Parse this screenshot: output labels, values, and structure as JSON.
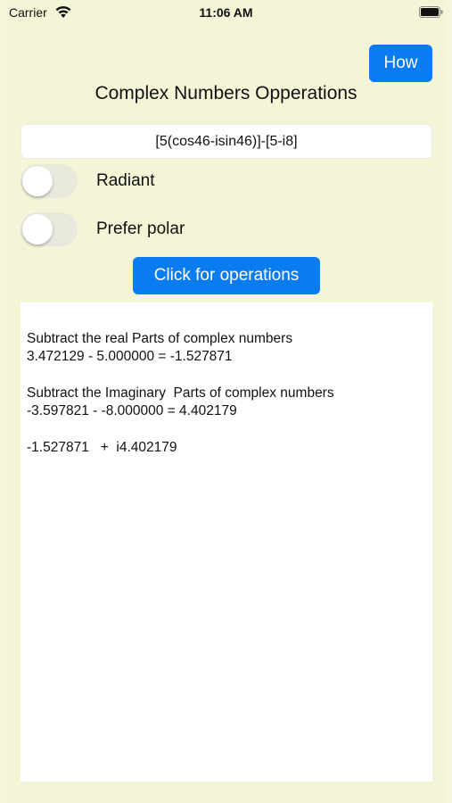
{
  "status_bar": {
    "carrier": "Carrier",
    "time": "11:06 AM"
  },
  "header": {
    "how_label": "How",
    "title": "Complex Numbers Opperations"
  },
  "input": {
    "expression": "[5(cos46-isin46)]-[5-i8]"
  },
  "toggles": [
    {
      "label": "Radiant",
      "on": false
    },
    {
      "label": "Prefer polar",
      "on": false
    }
  ],
  "ops_button_label": "Click for operations",
  "result": {
    "real_heading": "Subtract the real Parts of complex numbers",
    "real_calc": "3.472129 - 5.000000 = -1.527871",
    "imag_heading": "Subtract the Imaginary  Parts of complex numbers",
    "imag_calc": "-3.597821 - -8.000000 = 4.402179",
    "final": "-1.527871   +  i4.402179"
  },
  "colors": {
    "accent": "#0a7cf2",
    "background": "#f4f4d6",
    "panel": "#ffffff"
  }
}
